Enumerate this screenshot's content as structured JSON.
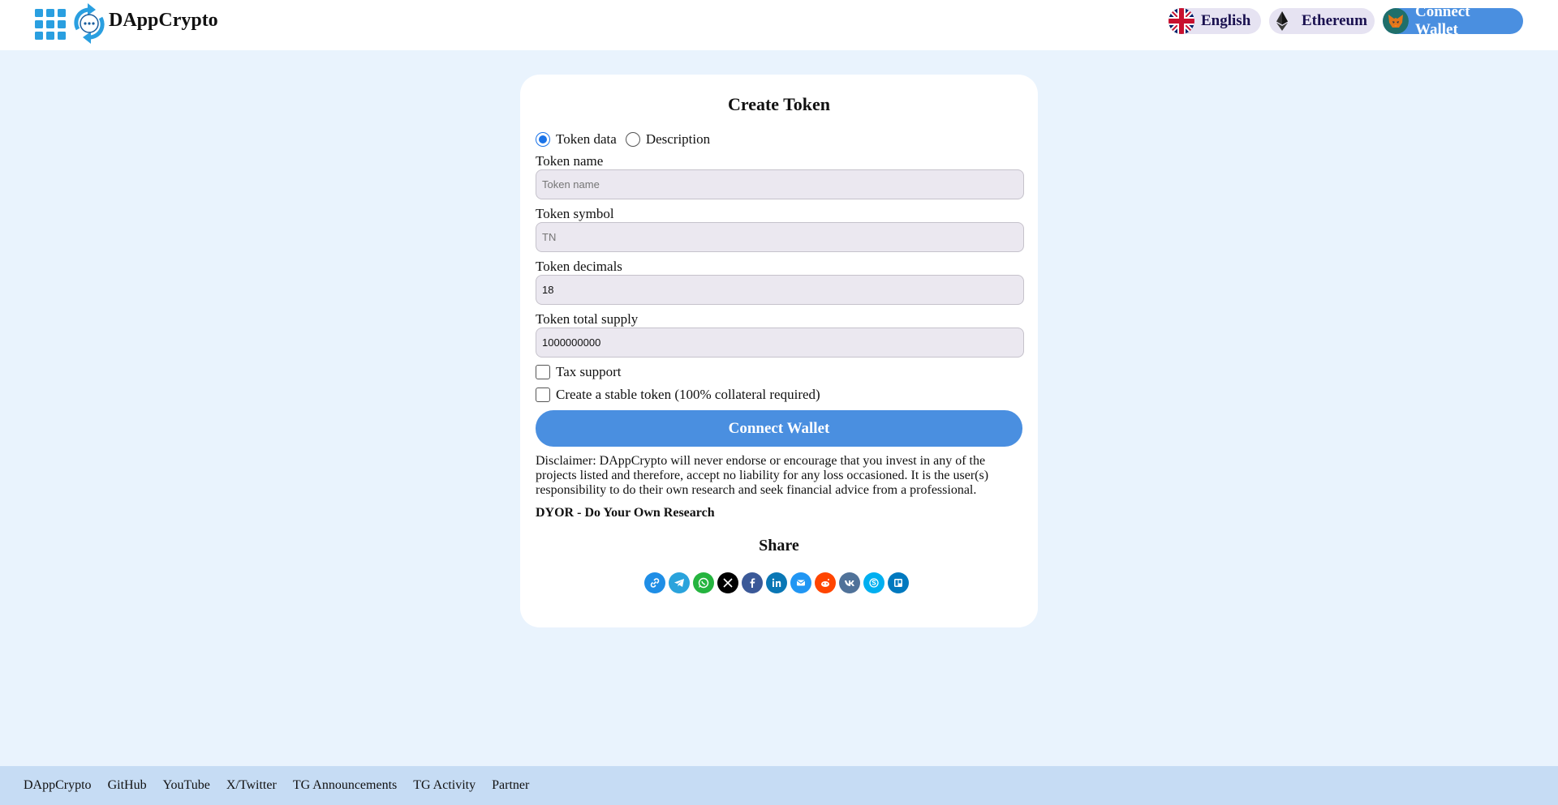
{
  "header": {
    "brand": "DAppCrypto",
    "language_label": "English",
    "network_label": "Ethereum",
    "wallet_label": "Connect Wallet"
  },
  "form": {
    "title": "Create Token",
    "tabs": [
      {
        "label": "Token data",
        "selected": true
      },
      {
        "label": "Description",
        "selected": false
      }
    ],
    "token_name": {
      "label": "Token name",
      "placeholder": "Token name",
      "value": ""
    },
    "token_symbol": {
      "label": "Token symbol",
      "placeholder": "TN",
      "value": ""
    },
    "token_decimals": {
      "label": "Token decimals",
      "value": "18"
    },
    "token_supply": {
      "label": "Token total supply",
      "value": "1000000000"
    },
    "tax_support": {
      "label": "Tax support",
      "checked": false
    },
    "stable_token": {
      "label": "Create a stable token (100% collateral required)",
      "checked": false
    },
    "submit_label": "Connect Wallet",
    "disclaimer": "Disclaimer: DAppCrypto will never endorse or encourage that you invest in any of the projects listed and therefore, accept no liability for any loss occasioned. It is the user(s) responsibility to do their own research and seek financial advice from a professional.",
    "dyor": "DYOR - Do Your Own Research",
    "share_title": "Share",
    "share_icons": [
      {
        "name": "link-icon",
        "color": "#1f8ee6"
      },
      {
        "name": "telegram-icon",
        "color": "#2aa3dc"
      },
      {
        "name": "whatsapp-icon",
        "color": "#25b43f"
      },
      {
        "name": "x-twitter-icon",
        "color": "#000000"
      },
      {
        "name": "facebook-icon",
        "color": "#3b5998"
      },
      {
        "name": "linkedin-icon",
        "color": "#0a77b5"
      },
      {
        "name": "email-icon",
        "color": "#2196f3"
      },
      {
        "name": "reddit-icon",
        "color": "#ff4500"
      },
      {
        "name": "vk-icon",
        "color": "#507299"
      },
      {
        "name": "skype-icon",
        "color": "#00aff0"
      },
      {
        "name": "trello-icon",
        "color": "#0079bf"
      }
    ]
  },
  "footer": {
    "links": [
      "DAppCrypto",
      "GitHub",
      "YouTube",
      "X/Twitter",
      "TG Announcements",
      "TG Activity",
      "Partner"
    ]
  },
  "colors": {
    "page_bg": "#e9f3fd",
    "accent": "#4a8fe0",
    "footer_bg": "#c6dcf4"
  }
}
